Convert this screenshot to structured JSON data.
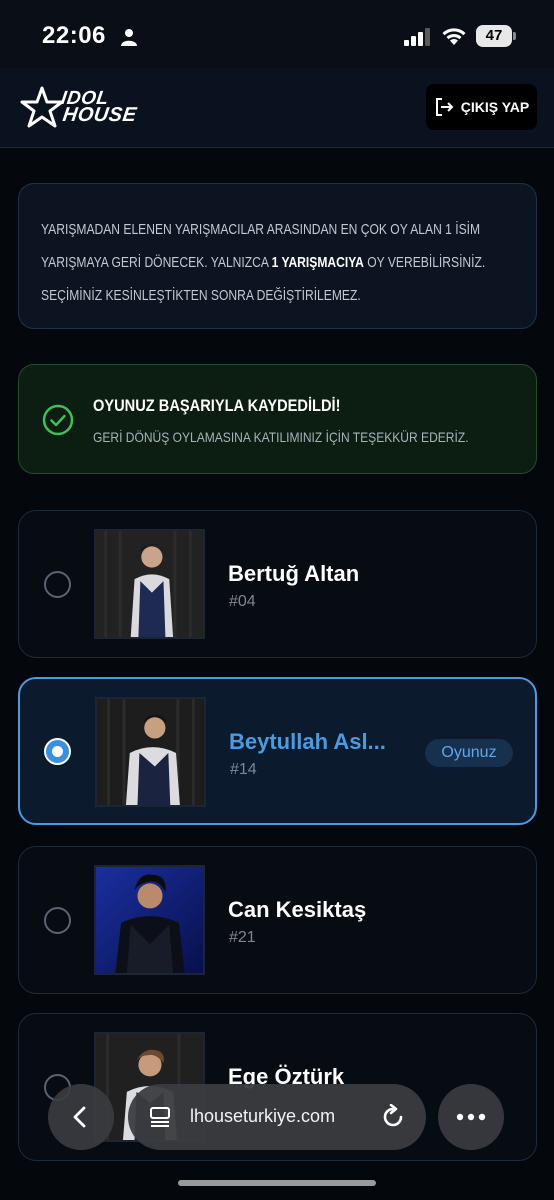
{
  "status_bar": {
    "time": "22:06",
    "battery": "47"
  },
  "header": {
    "logo_line1": "IDOL",
    "logo_line2": "HOUSE",
    "logout_label": "ÇIKIŞ YAP"
  },
  "info": {
    "text_before": "YARIŞMADAN ELENEN YARIŞMACILAR ARASINDAN EN ÇOK OY ALAN 1 İSİM YARIŞMAYA GERİ DÖNECEK. YALNIZCA ",
    "text_bold": "1 YARIŞMACIYA",
    "text_after": " OY VEREBİLİRSİNİZ. SEÇİMİNİZ KESİNLEŞTİKTEN SONRA DEĞİŞTİRİLEMEZ."
  },
  "success": {
    "title": "OYUNUZ BAŞARIYLA KAYDEDİLDİ!",
    "subtitle": "GERİ DÖNÜŞ OYLAMASINA KATILIMINIZ İÇİN TEŞEKKÜR EDERİZ."
  },
  "contestants": [
    {
      "name": "Bertuğ Altan",
      "number": "#04",
      "selected": false
    },
    {
      "name": "Beytullah Asl...",
      "number": "#14",
      "selected": true,
      "badge": "Oyunuz"
    },
    {
      "name": "Can Kesiktaş",
      "number": "#21",
      "selected": false
    },
    {
      "name": "Ege Öztürk",
      "number": "",
      "selected": false
    }
  ],
  "browser": {
    "url": "lhouseturkiye.com"
  },
  "colors": {
    "accent": "#4a9be0",
    "success": "#3fbf5a",
    "background": "#04070c"
  }
}
